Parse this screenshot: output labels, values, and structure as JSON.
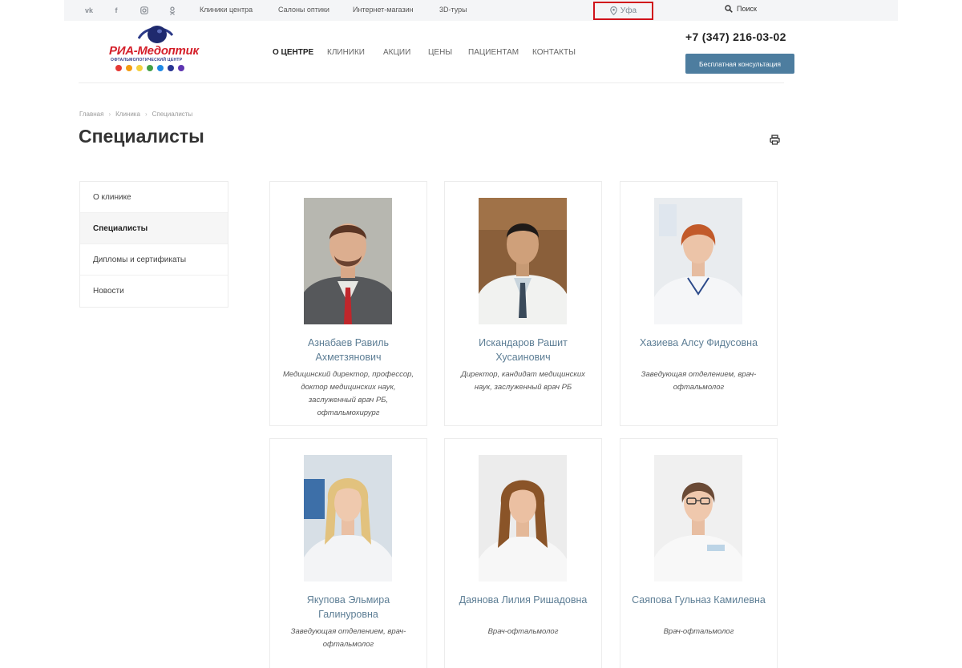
{
  "topbar": {
    "social_icons": [
      "vk-icon",
      "facebook-icon",
      "instagram-icon",
      "odnoklassniki-icon"
    ],
    "links": [
      "Клиники центра",
      "Салоны оптики",
      "Интернет-магазин",
      "3D-туры"
    ],
    "city": "Уфа",
    "search_label": "Поиск"
  },
  "logo": {
    "brand": "РИА-Медоптик",
    "subtitle": "ОФТАЛЬМОЛОГИЧЕСКИЙ ЦЕНТР",
    "dot_colors": [
      "#e53935",
      "#f39c12",
      "#f4d03f",
      "#43a047",
      "#1e88e5",
      "#283593",
      "#5e35b1"
    ]
  },
  "nav": [
    "О центре",
    "Клиники",
    "Акции",
    "Цены",
    "Пациентам",
    "Контакты"
  ],
  "header": {
    "phone": "+7 (347) 216-03-02",
    "consult_button": "Бесплатная консультация"
  },
  "breadcrumbs": [
    "Главная",
    "Клиника",
    "Специалисты"
  ],
  "page_title": "Специалисты",
  "sidemenu": [
    "О клинике",
    "Специалисты",
    "Дипломы и сертификаты",
    "Новости"
  ],
  "specialists": [
    {
      "name": "Азнабаев Равиль Ахметзянович",
      "role": "Медицинский директор, профессор, доктор медицинских наук, заслуженный врач РБ, офтальмохирург"
    },
    {
      "name": "Искандаров Рашит Хусаинович",
      "role": "Директор, кандидат медицинских наук, заслуженный врач РБ"
    },
    {
      "name": "Хазиева Алсу Фидусовна",
      "role": "Заведующая отделением, врач-офтальмолог"
    },
    {
      "name": "Якупова Эльмира Галинуровна",
      "role": "Заведующая отделением, врач-офтальмолог"
    },
    {
      "name": "Даянова Лилия Ришадовна",
      "role": "Врач-офтальмолог"
    },
    {
      "name": "Саяпова Гульназ Камилевна",
      "role": "Врач-офтальмолог"
    }
  ],
  "colors": {
    "accent_button": "#4d7d9f",
    "name_link": "#5d7e95",
    "city_highlight": "#d0121b"
  }
}
